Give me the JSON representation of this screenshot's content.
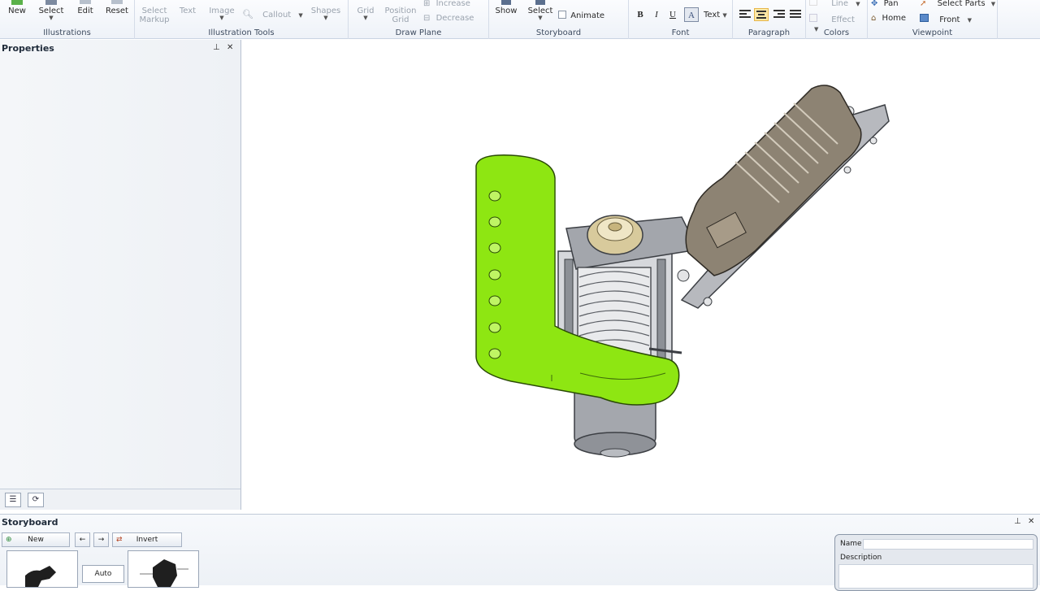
{
  "ribbon": {
    "illustrations": {
      "label": "Illustrations",
      "new": "New",
      "select": "Select",
      "edit": "Edit",
      "reset": "Reset"
    },
    "illustration_tools": {
      "label": "Illustration Tools",
      "select_markup_1": "Select",
      "select_markup_2": "Markup",
      "text": "Text",
      "image": "Image",
      "callout": "Callout",
      "shapes": "Shapes"
    },
    "draw_plane": {
      "label": "Draw Plane",
      "grid": "Grid",
      "position_grid_1": "Position",
      "position_grid_2": "Grid",
      "increase": "Increase",
      "decrease": "Decrease"
    },
    "storyboard": {
      "label": "Storyboard",
      "show": "Show",
      "select": "Select",
      "animate": "Animate"
    },
    "font": {
      "label": "Font",
      "bold": "B",
      "italic": "I",
      "underline": "U",
      "highlight": "A",
      "text": "Text"
    },
    "paragraph": {
      "label": "Paragraph"
    },
    "colors": {
      "label": "Colors",
      "line": "Line",
      "effect": "Effect"
    },
    "viewpoint": {
      "label": "Viewpoint",
      "pan": "Pan",
      "home": "Home",
      "select_parts": "Select Parts",
      "front": "Front"
    }
  },
  "properties": {
    "title": "Properties"
  },
  "storyboard_panel": {
    "title": "Storyboard",
    "new": "New",
    "invert": "Invert",
    "auto": "Auto",
    "name_label": "Name",
    "description_label": "Description"
  },
  "colors": {
    "accent_green": "#8ee612",
    "selection_yellow": "#fde8a8",
    "part_gray": "#a9acb1",
    "housing_bronze": "#8d8373"
  },
  "icons": [
    "new-icon",
    "select-icon",
    "edit-icon",
    "reset-icon",
    "callout-icon",
    "grid-icon",
    "increase-icon",
    "decrease-icon",
    "show-icon",
    "pan-icon",
    "home-icon",
    "select-parts-icon",
    "front-icon",
    "pin-icon",
    "close-icon",
    "list-icon",
    "refresh-icon",
    "back-arrow-icon",
    "forward-arrow-icon",
    "invert-icon"
  ]
}
